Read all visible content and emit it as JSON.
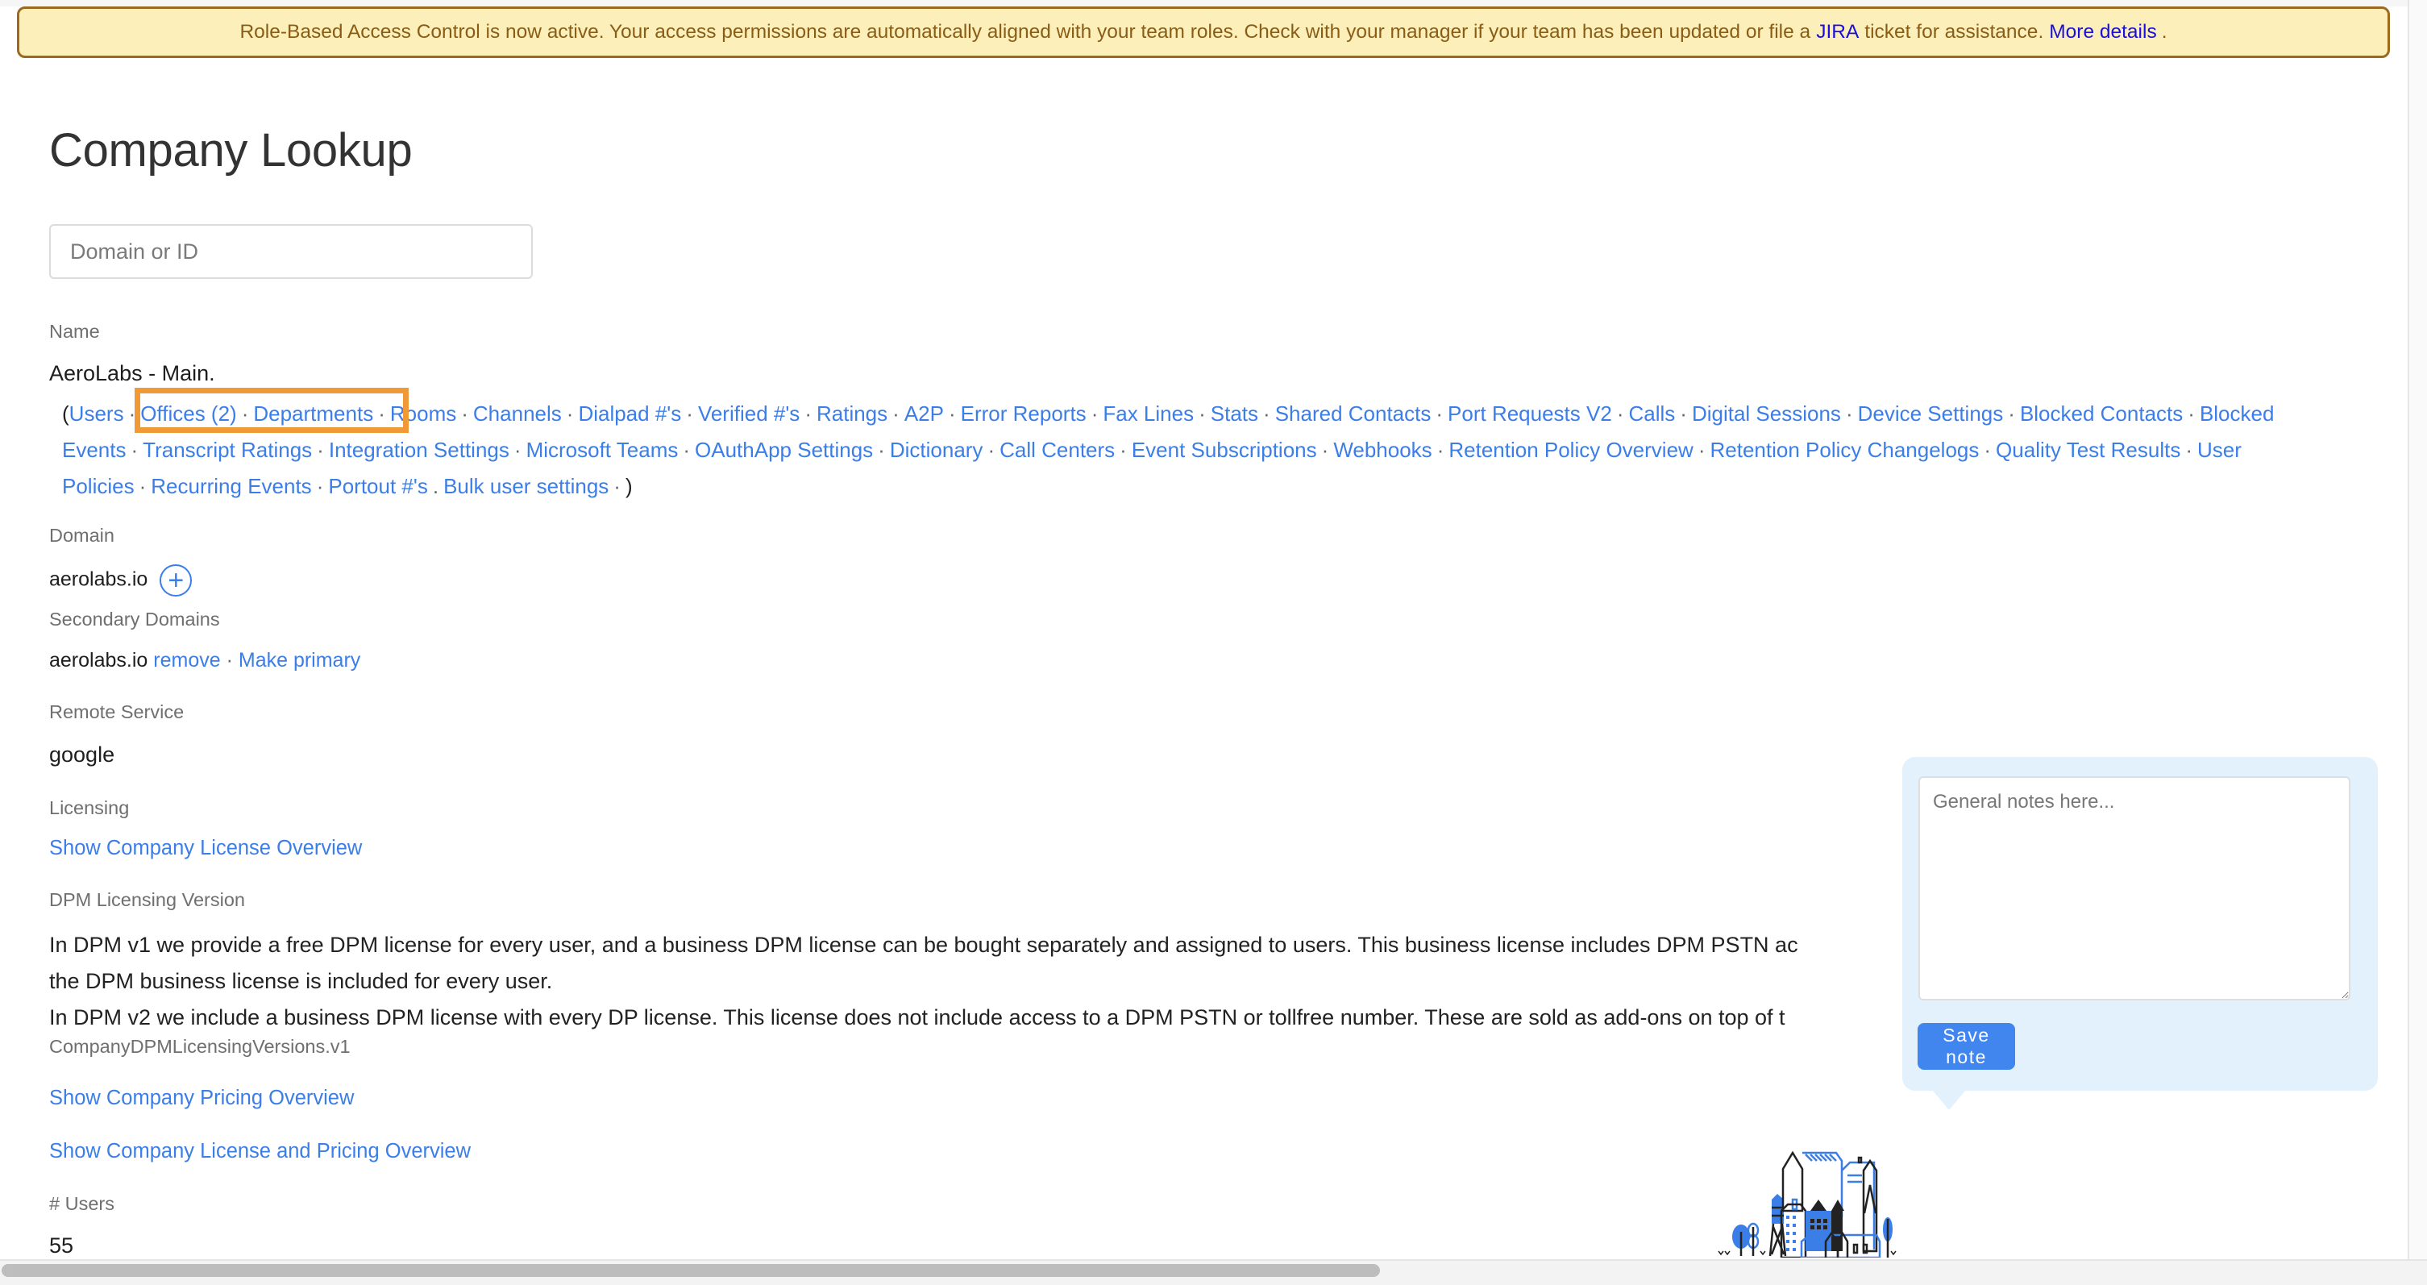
{
  "banner": {
    "text_before": "Role-Based Access Control is now active. Your access permissions are automatically aligned with your team roles. Check with your manager if your team has been updated or file a",
    "jira_link": "JIRA",
    "text_middle": "ticket for assistance.",
    "more_link": "More details",
    "text_end": "."
  },
  "page": {
    "title": "Company Lookup",
    "search_placeholder": "Domain or ID",
    "search_value": ""
  },
  "company": {
    "name_label": "Name",
    "name_value": "AeroLabs - Main.",
    "open_paren": "(",
    "close_paren": ")",
    "separator": "·",
    "links": [
      "Users",
      "Offices (2)",
      "Departments",
      "Rooms",
      "Channels",
      "Dialpad #'s",
      "Verified #'s",
      "Ratings",
      "A2P",
      "Error Reports",
      "Fax Lines",
      "Stats",
      "Shared Contacts",
      "Port Requests V2",
      "Calls",
      "Digital Sessions",
      "Device Settings",
      "Blocked Contacts",
      "Blocked Events",
      "Transcript Ratings",
      "Integration Settings",
      "Microsoft Teams",
      "OAuthApp Settings",
      "Dictionary",
      "Call Centers",
      "Event Subscriptions",
      "Webhooks",
      "Retention Policy Overview",
      "Retention Policy Changelogs",
      "Quality Test Results",
      "User Policies",
      "Recurring Events",
      "Portout #'s",
      "Bulk user settings"
    ],
    "highlighted_links": [
      "Offices (2)",
      "Departments"
    ],
    "domain_label": "Domain",
    "domain_value": "aerolabs.io",
    "add_domain_icon": "plus-circle-icon",
    "secondary_domains_label": "Secondary Domains",
    "secondary_domain_value": "aerolabs.io",
    "secondary_remove": "remove",
    "secondary_make_primary": "Make primary",
    "remote_service_label": "Remote Service",
    "remote_service_value": "google",
    "licensing_label": "Licensing",
    "licensing_link": "Show Company License Overview",
    "dpm_label": "DPM Licensing Version",
    "dpm_line1": "In DPM v1 we provide a free DPM license for every user, and a business DPM license can be bought separately and assigned to users. This business license includes DPM PSTN ac",
    "dpm_line2": "the DPM business license is included for every user.",
    "dpm_line3": "In DPM v2 we include a business DPM license with every DP license. This license does not include access to a DPM PSTN or tollfree number. These are sold as add-ons on top of t",
    "dpm_version_key": "CompanyDPMLicensingVersions.v1",
    "pricing_link": "Show Company Pricing Overview",
    "license_pricing_link": "Show Company License and Pricing Overview",
    "users_label": "# Users",
    "users_value": "55"
  },
  "notes": {
    "placeholder": "General notes here...",
    "value": "",
    "save_label": "Save note"
  },
  "illustration": "city-buildings-illustration",
  "colors": {
    "link": "#3b7ee8",
    "banner_bg": "#fcefb9",
    "banner_border": "#9b6a1f",
    "highlight": "#f09a37",
    "note_panel": "#e3f1fc",
    "save_button": "#4186ef"
  }
}
